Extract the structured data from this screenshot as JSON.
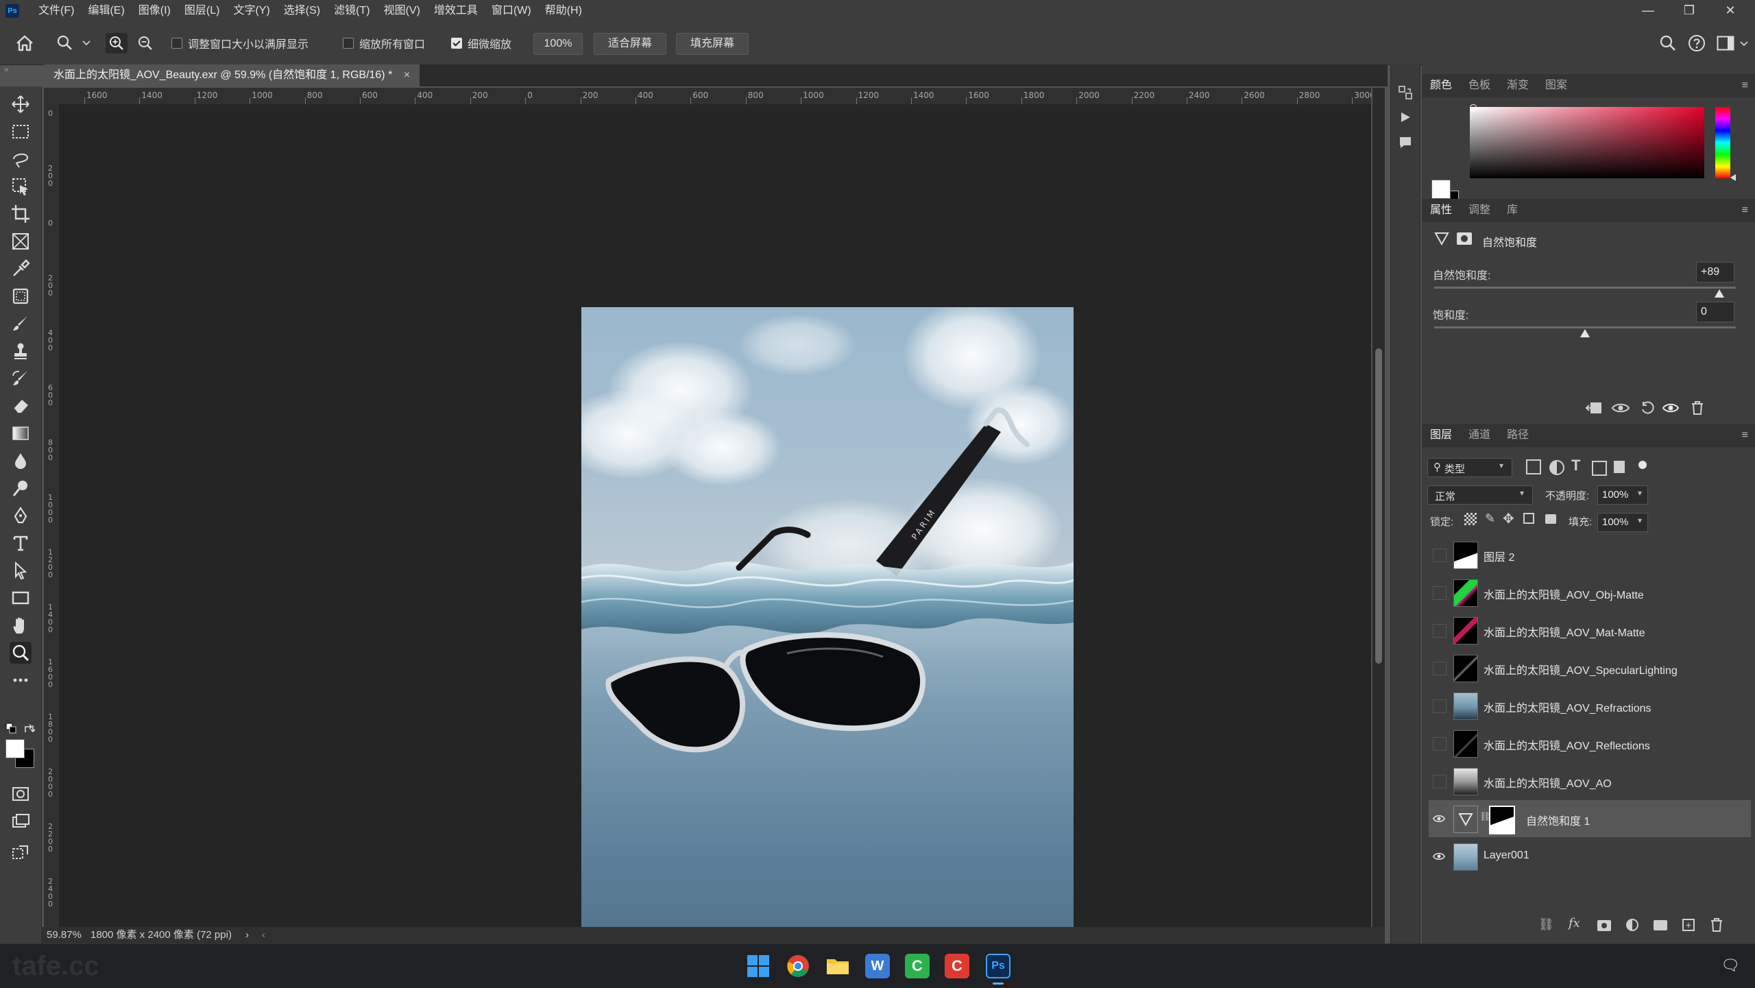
{
  "app": {
    "logo": "Ps"
  },
  "menubar": {
    "items": [
      "文件(F)",
      "编辑(E)",
      "图像(I)",
      "图层(L)",
      "文字(Y)",
      "选择(S)",
      "滤镜(T)",
      "视图(V)",
      "增效工具",
      "窗口(W)",
      "帮助(H)"
    ]
  },
  "window_controls": {
    "minimize": "—",
    "restore": "❐",
    "close": "✕"
  },
  "options": {
    "resize_window": "调整窗口大小以满屏显示",
    "zoom_all": "缩放所有窗口",
    "scrubby_zoom": "细微缩放",
    "zoom_value": "100%",
    "fit_screen": "适合屏幕",
    "fill_screen": "填充屏幕"
  },
  "document": {
    "tab_title": "水面上的太阳镜_AOV_Beauty.exr @ 59.9% (自然饱和度 1, RGB/16) *",
    "close": "×"
  },
  "ruler_top_labels": [
    "1600",
    "1400",
    "1200",
    "1000",
    "800",
    "600",
    "400",
    "200",
    "0",
    "200",
    "400",
    "600",
    "800",
    "1000",
    "1200",
    "1400",
    "1600",
    "1800",
    "2000",
    "2200",
    "2400",
    "2600",
    "2800",
    "3000"
  ],
  "ruler_left_labels": [
    "0",
    "2\n0\n0",
    "0",
    "2\n0\n0",
    "4\n0\n0",
    "6\n0\n0",
    "8\n0\n0",
    "1\n0\n0\n0",
    "1\n2\n0\n0",
    "1\n4\n0\n0",
    "1\n6\n0\n0",
    "1\n8\n0\n0",
    "2\n0\n0\n0",
    "2\n2\n0\n0",
    "2\n4\n0\n0"
  ],
  "status": {
    "zoom": "59.87%",
    "size": "1800 像素 x 2400 像素 (72 ppi)",
    "arrow": "›",
    "left_arrow": "‹"
  },
  "color_panel": {
    "tabs": [
      "颜色",
      "色板",
      "渐变",
      "图案"
    ]
  },
  "properties_panel": {
    "tabs": [
      "属性",
      "调整",
      "库"
    ],
    "adjustment_name": "自然饱和度",
    "vibrance_label": "自然饱和度:",
    "vibrance_value": "+89",
    "vibrance_fraction": 0.945,
    "saturation_label": "饱和度:",
    "saturation_value": "0",
    "saturation_fraction": 0.5
  },
  "layers_panel": {
    "tabs": [
      "图层",
      "通道",
      "路径"
    ],
    "filter_kind": "类型",
    "blend_mode": "正常",
    "opacity_label": "不透明度:",
    "opacity_value": "100%",
    "lock_label": "锁定:",
    "fill_label": "填充:",
    "fill_value": "100%",
    "layers": [
      {
        "name": "图层 2",
        "visible": false,
        "thumb": "mask"
      },
      {
        "name": "水面上的太阳镜_AOV_Obj-Matte",
        "visible": false,
        "thumb": "matte-green"
      },
      {
        "name": "水面上的太阳镜_AOV_Mat-Matte",
        "visible": false,
        "thumb": "matte-red"
      },
      {
        "name": "水面上的太阳镜_AOV_SpecularLighting",
        "visible": false,
        "thumb": "dark"
      },
      {
        "name": "水面上的太阳镜_AOV_Refractions",
        "visible": false,
        "thumb": "blue"
      },
      {
        "name": "水面上的太阳镜_AOV_Reflections",
        "visible": false,
        "thumb": "dark"
      },
      {
        "name": "水面上的太阳镜_AOV_AO",
        "visible": false,
        "thumb": "gray"
      },
      {
        "name": "自然饱和度 1",
        "visible": true,
        "thumb": "adjustment",
        "selected": true
      },
      {
        "name": "Layer001",
        "visible": true,
        "thumb": "photo"
      }
    ]
  },
  "watermark": "tafe.cc"
}
